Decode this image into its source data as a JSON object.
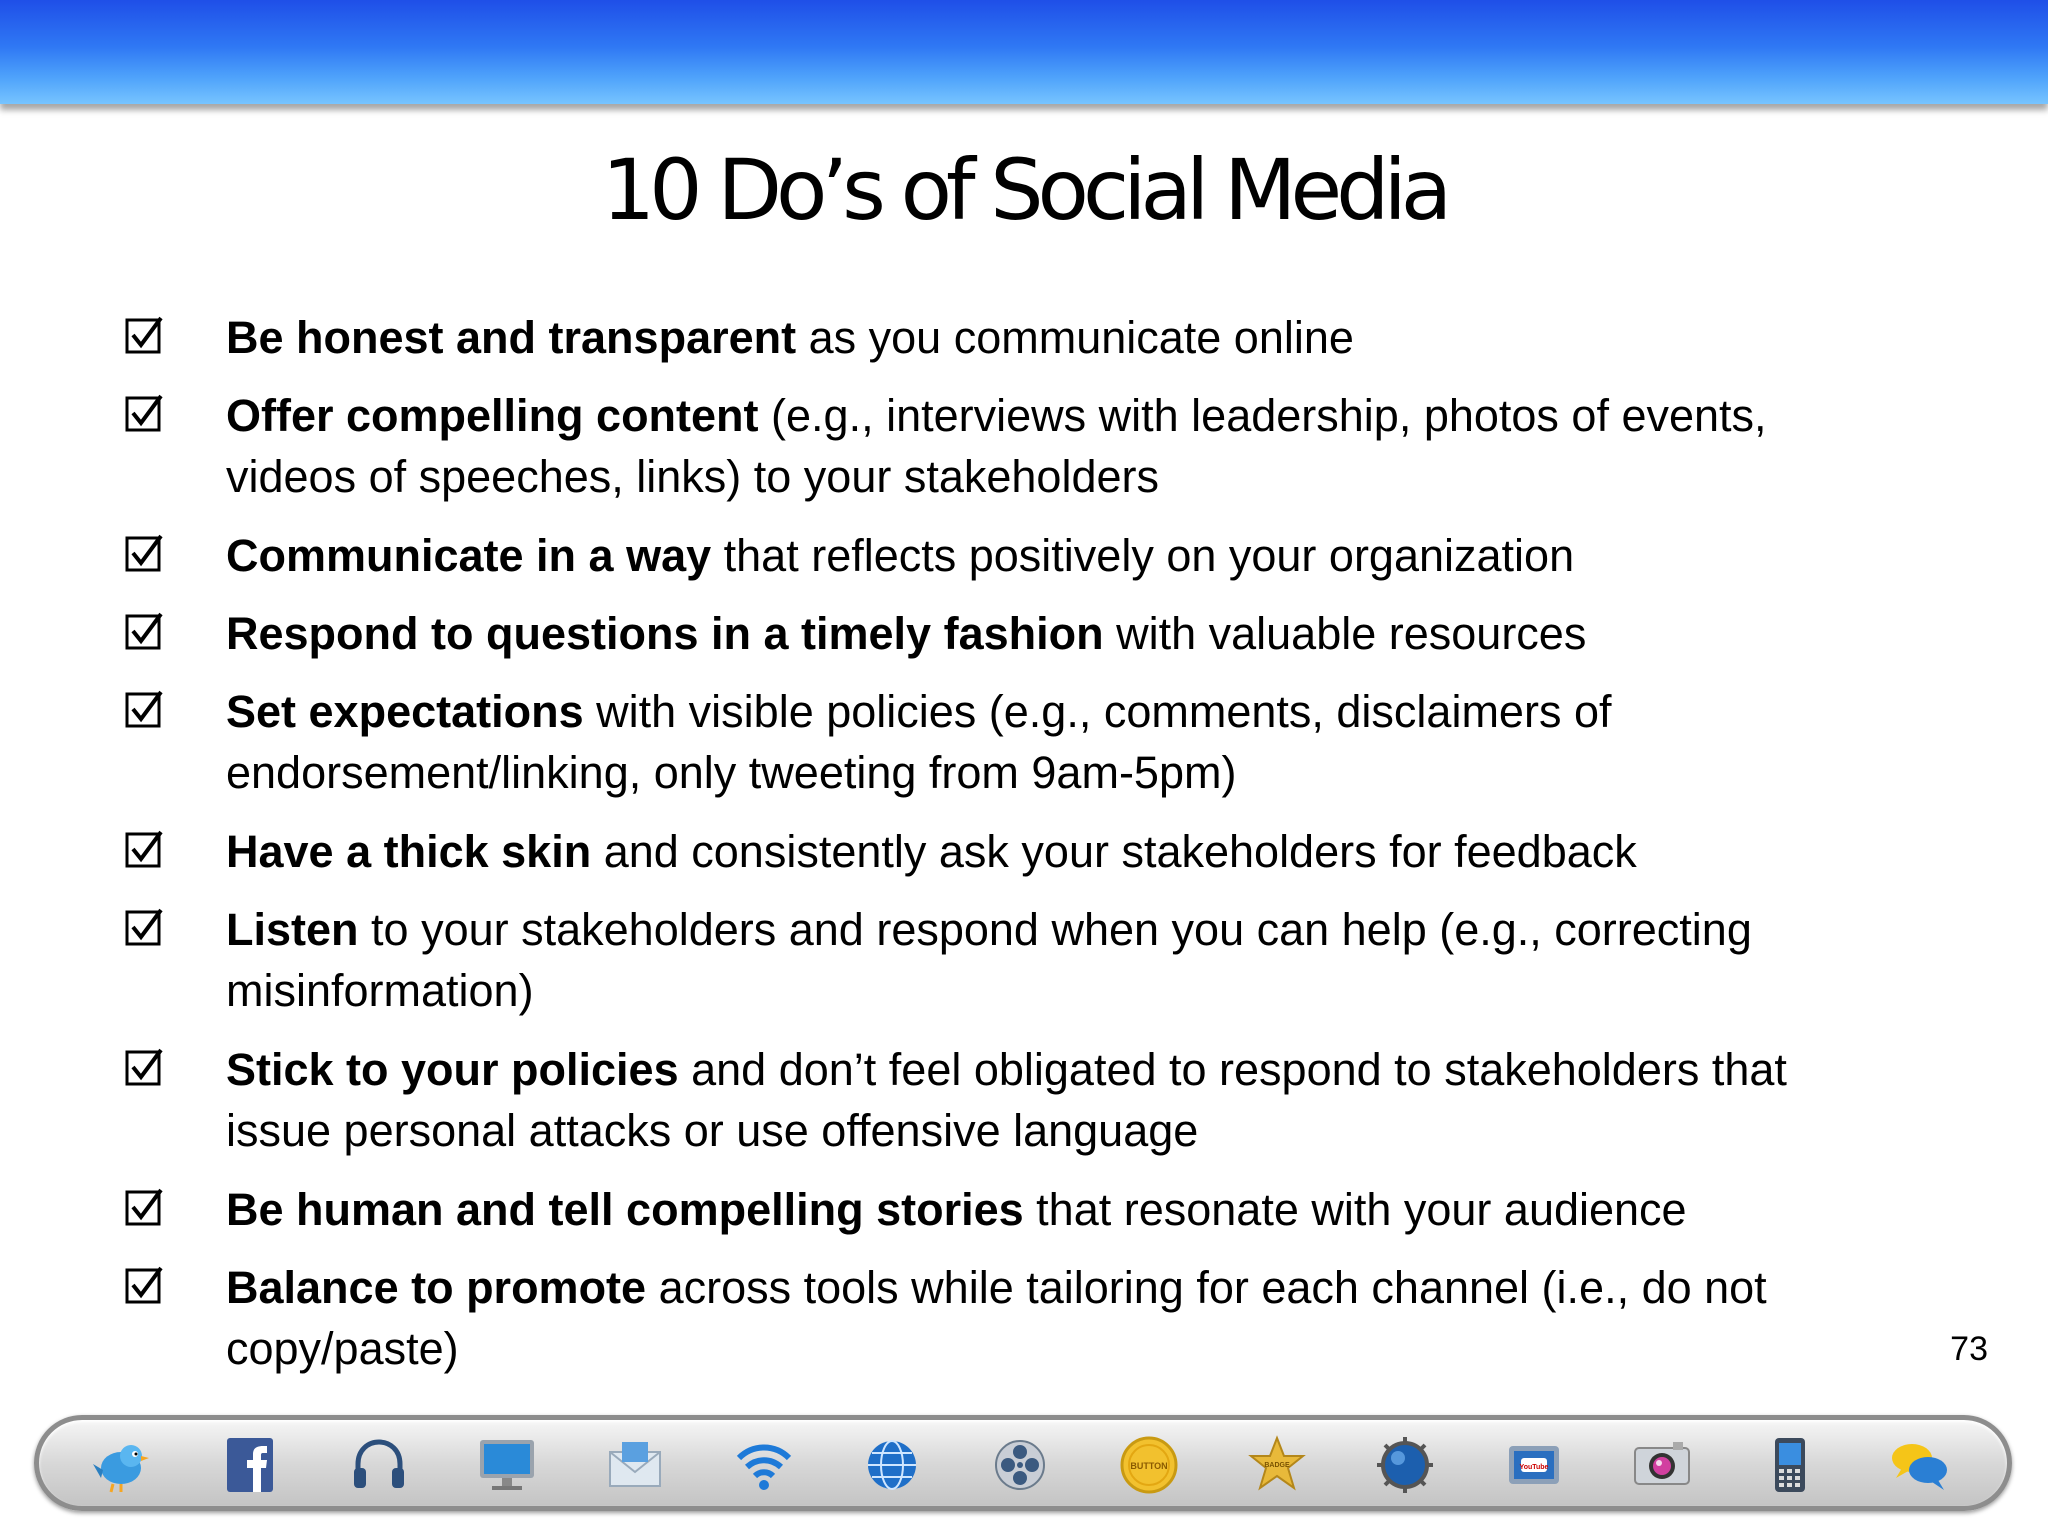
{
  "slide": {
    "title": "10 Do’s of Social Media",
    "page_number": "73"
  },
  "items": [
    {
      "bold": "Be honest and transparent",
      "rest": " as you communicate online"
    },
    {
      "bold": "Offer compelling content",
      "rest": " (e.g., interviews with leadership, photos of events, videos of speeches, links) to your stakeholders"
    },
    {
      "bold": "Communicate in a way",
      "rest": " that reflects positively on your organization"
    },
    {
      "bold": "Respond to questions in a timely fashion",
      "rest": " with valuable resources"
    },
    {
      "bold": "Set expectations",
      "rest": " with visible policies (e.g., comments, disclaimers of endorsement/linking, only tweeting from 9am-5pm)"
    },
    {
      "bold": "Have a thick skin",
      "rest": " and consistently ask your stakeholders for feedback"
    },
    {
      "bold": "Listen",
      "rest": " to your stakeholders and respond when you can help (e.g., correcting misinformation)"
    },
    {
      "bold": "Stick to your policies",
      "rest": " and don’t feel obligated to respond to stakeholders that issue personal attacks or use offensive language"
    },
    {
      "bold": "Be human and tell compelling stories",
      "rest": " that resonate with your audience"
    },
    {
      "bold": "Balance to promote",
      "rest": " across tools while tailoring for each channel (i.e., do not copy/paste)"
    }
  ],
  "dock": {
    "icons": [
      "bird-icon",
      "facebook-icon",
      "headphones-icon",
      "monitor-icon",
      "mail-icon",
      "wifi-icon",
      "globe-icon",
      "film-reel-icon",
      "button-badge-icon",
      "sheriff-badge-icon",
      "sphere-icon",
      "youtube-tv-icon",
      "camera-icon",
      "mobile-phone-icon",
      "chat-bubbles-icon"
    ],
    "badge_text": "BUTTON",
    "star_text": "BADGE",
    "tv_text": "YouTube",
    "colors": {
      "banner_top": "#1f4fe8",
      "banner_bottom": "#77c4ff",
      "dock_border": "#8d8d8d"
    }
  }
}
